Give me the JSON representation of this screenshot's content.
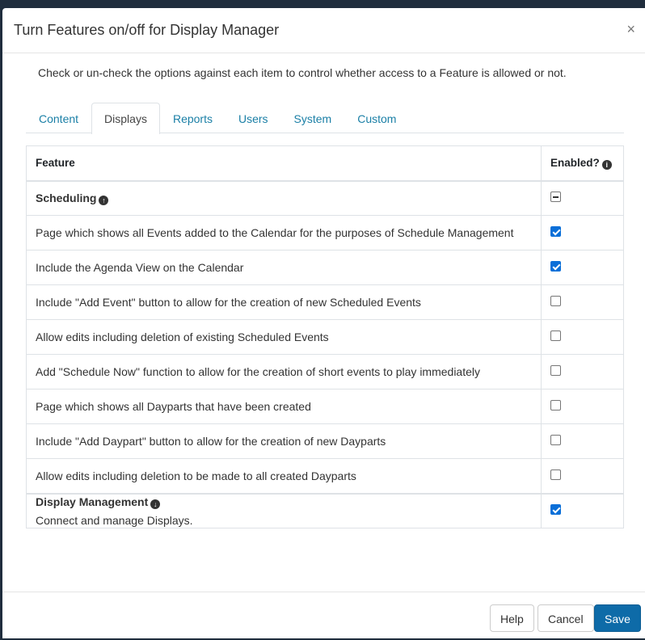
{
  "modal": {
    "title": "Turn Features on/off for Display Manager",
    "close_label": "×",
    "intro": "Check or un-check the options against each item to control whether access to a Feature is allowed or not."
  },
  "tabs": [
    {
      "label": "Content",
      "active": false
    },
    {
      "label": "Displays",
      "active": true
    },
    {
      "label": "Reports",
      "active": false
    },
    {
      "label": "Users",
      "active": false
    },
    {
      "label": "System",
      "active": false
    },
    {
      "label": "Custom",
      "active": false
    }
  ],
  "table": {
    "header_feature": "Feature",
    "header_enabled": "Enabled?",
    "groups": [
      {
        "title": "Scheduling",
        "state": "indeterminate",
        "items": [
          {
            "label": "Page which shows all Events added to the Calendar for the purposes of Schedule Management",
            "checked": true
          },
          {
            "label": "Include the Agenda View on the Calendar",
            "checked": true
          },
          {
            "label": "Include \"Add Event\" button to allow for the creation of new Scheduled Events",
            "checked": false
          },
          {
            "label": "Allow edits including deletion of existing Scheduled Events",
            "checked": false
          },
          {
            "label": "Add \"Schedule Now\" function to allow for the creation of short events to play immediately",
            "checked": false
          },
          {
            "label": "Page which shows all Dayparts that have been created",
            "checked": false
          },
          {
            "label": "Include \"Add Daypart\" button to allow for the creation of new Dayparts",
            "checked": false
          },
          {
            "label": "Allow edits including deletion to be made to all created Dayparts",
            "checked": false
          }
        ]
      },
      {
        "title": "Display Management",
        "subtitle": "Connect and manage Displays.",
        "state": "checked"
      }
    ]
  },
  "footer": {
    "help_label": "Help",
    "cancel_label": "Cancel",
    "save_label": "Save"
  },
  "colors": {
    "accent": "#0e6ba8",
    "tab_link": "#1a7fa6",
    "checkbox_checked": "#0a6fd8"
  }
}
